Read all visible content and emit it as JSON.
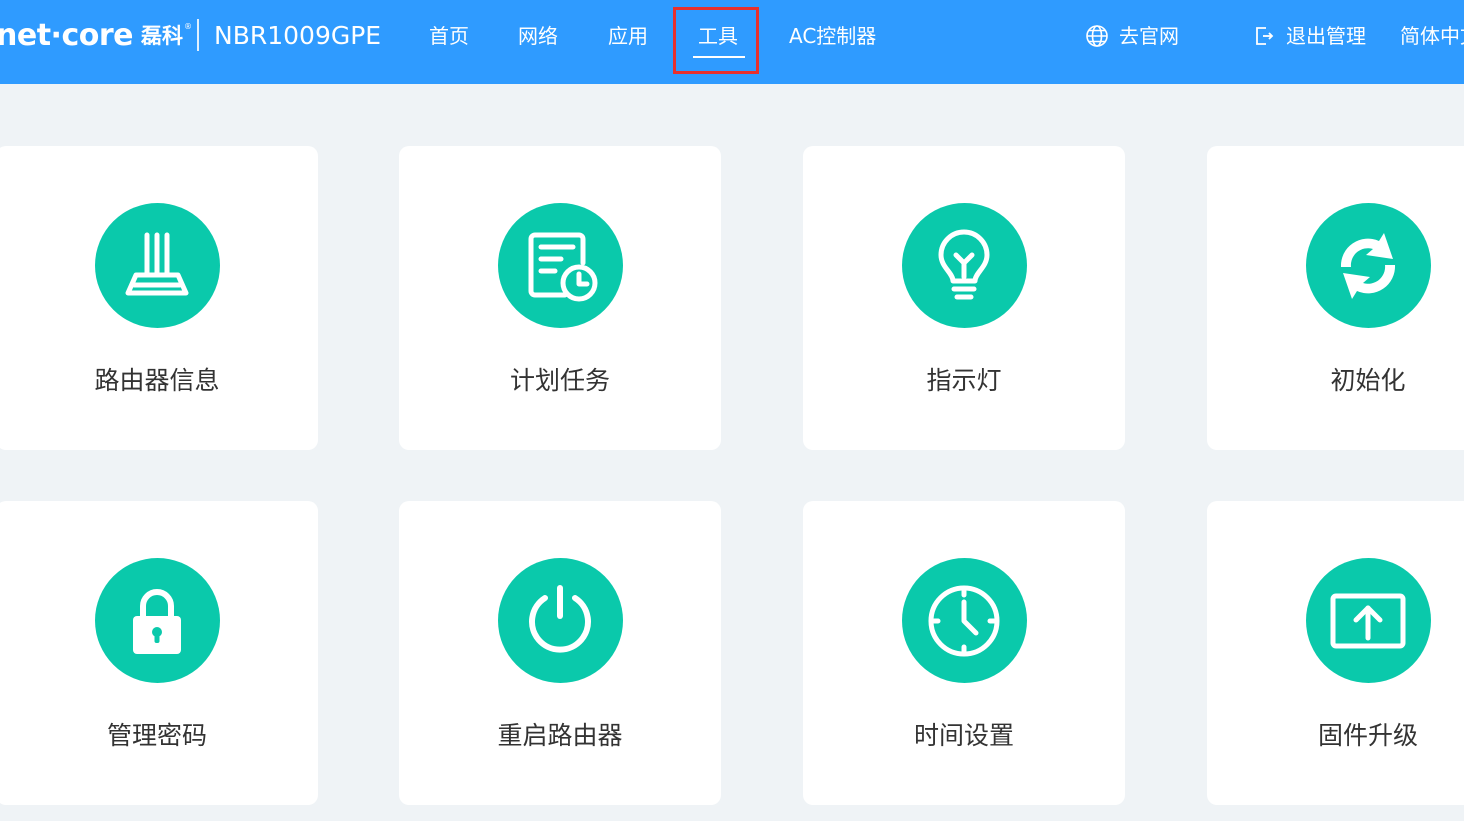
{
  "header": {
    "brand_logo": "net·core",
    "brand_cn": "磊科",
    "brand_reg": "®",
    "model": "NBR1009GPE",
    "nav": [
      "首页",
      "网络",
      "应用",
      "工具",
      "AC控制器"
    ],
    "active_nav": "工具",
    "official_site": "去官网",
    "logout": "退出管理",
    "language": "简体中文",
    "bar_color": "#2f9bff",
    "highlight_color": "#e8302d"
  },
  "tools": [
    {
      "label": "路由器信息",
      "icon": "router-icon"
    },
    {
      "label": "计划任务",
      "icon": "scheduled-task-icon"
    },
    {
      "label": "指示灯",
      "icon": "lightbulb-icon"
    },
    {
      "label": "初始化",
      "icon": "reset-icon"
    },
    {
      "label": "管理密码",
      "icon": "lock-icon"
    },
    {
      "label": "重启路由器",
      "icon": "power-icon"
    },
    {
      "label": "时间设置",
      "icon": "clock-icon"
    },
    {
      "label": "固件升级",
      "icon": "upload-icon"
    }
  ],
  "theme": {
    "accent": "#0ac9ab",
    "background": "#eff3f6",
    "card": "#ffffff",
    "text": "#333333"
  }
}
